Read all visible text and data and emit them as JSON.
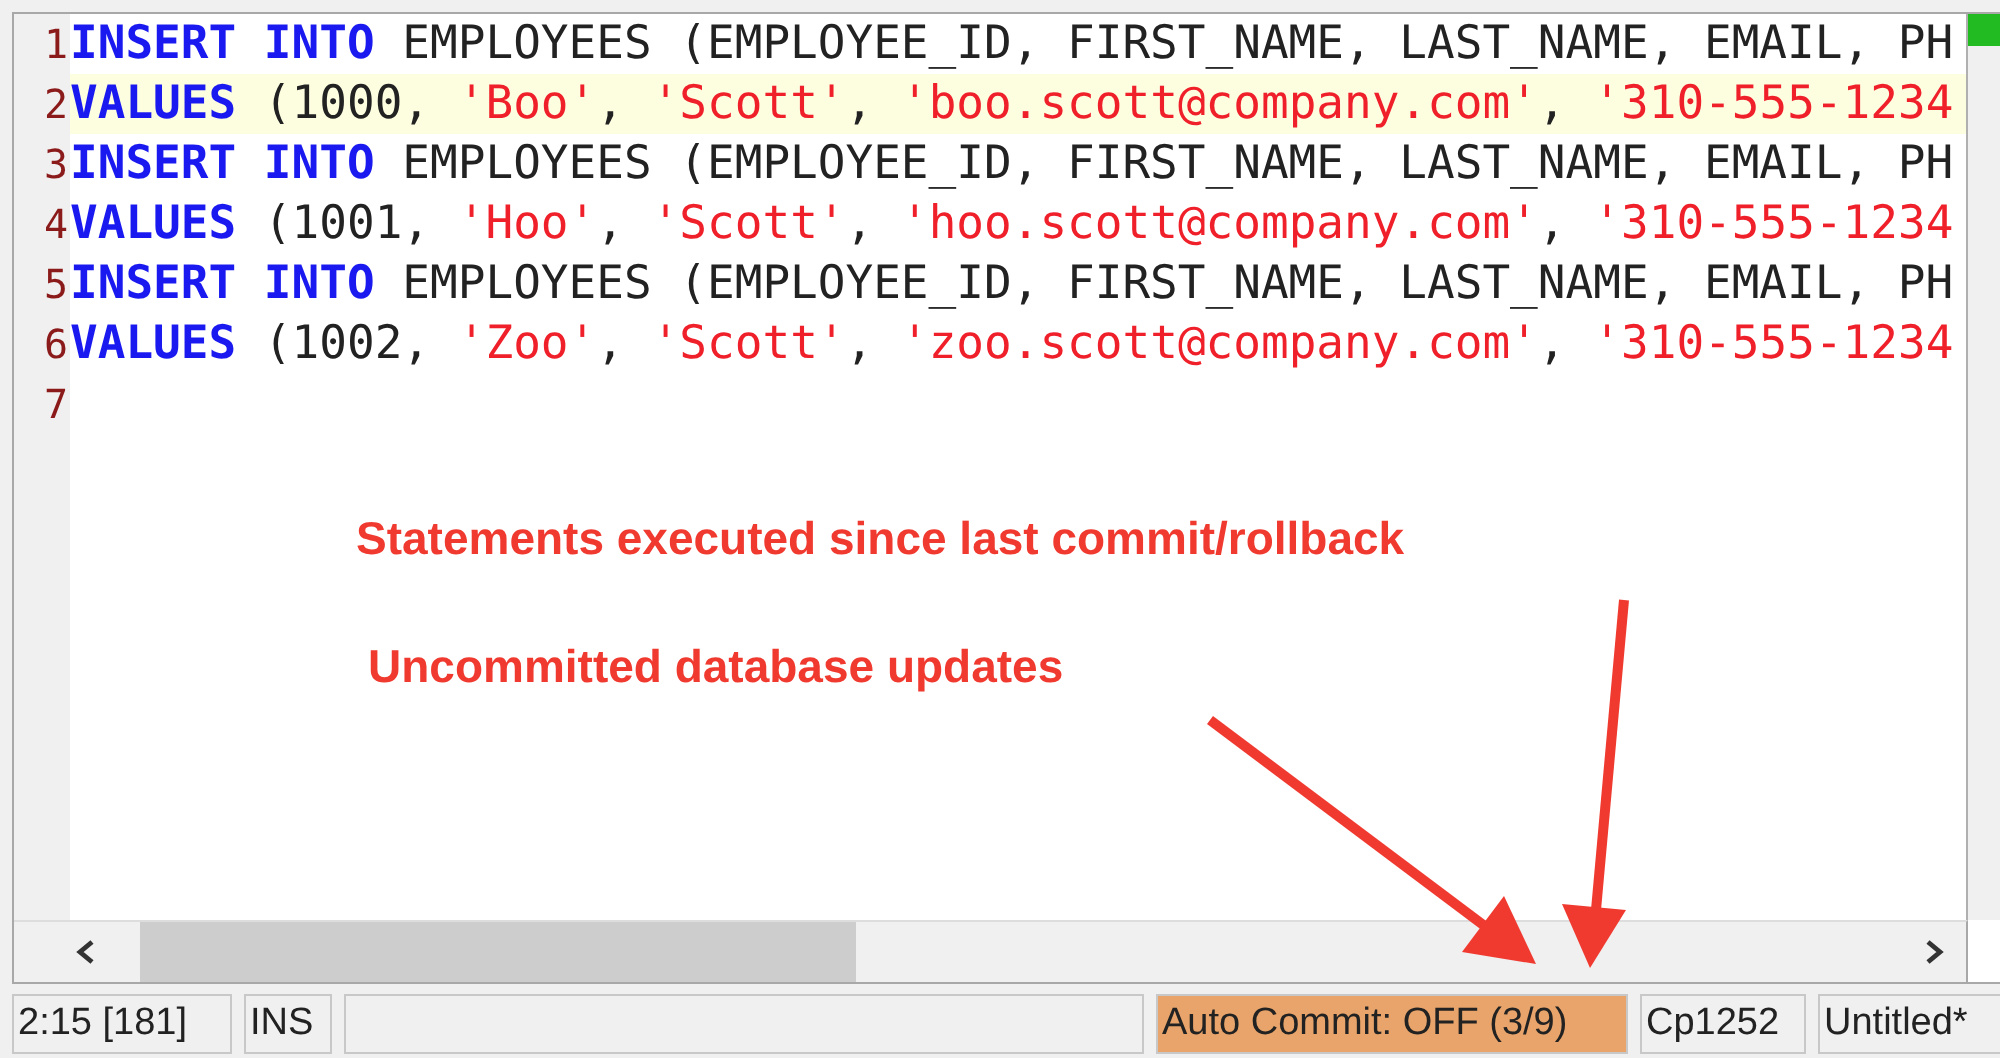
{
  "editor": {
    "lines": [
      {
        "number": "1",
        "current": false,
        "tokens": [
          {
            "kind": "keyword",
            "text": "INSERT INTO"
          },
          {
            "kind": "plain",
            "text": " EMPLOYEES (EMPLOYEE_ID, FIRST_NAME, LAST_NAME, EMAIL, PH"
          }
        ]
      },
      {
        "number": "2",
        "current": true,
        "tokens": [
          {
            "kind": "keyword",
            "text": "VALUES"
          },
          {
            "kind": "plain",
            "text": " (1000, "
          },
          {
            "kind": "string",
            "text": "'Boo'"
          },
          {
            "kind": "plain",
            "text": ", "
          },
          {
            "kind": "string",
            "text": "'Scott'"
          },
          {
            "kind": "plain",
            "text": ", "
          },
          {
            "kind": "string",
            "text": "'boo.scott@company.com'"
          },
          {
            "kind": "plain",
            "text": ", "
          },
          {
            "kind": "string",
            "text": "'310-555-1234"
          }
        ]
      },
      {
        "number": "3",
        "current": false,
        "tokens": [
          {
            "kind": "keyword",
            "text": "INSERT INTO"
          },
          {
            "kind": "plain",
            "text": " EMPLOYEES (EMPLOYEE_ID, FIRST_NAME, LAST_NAME, EMAIL, PH"
          }
        ]
      },
      {
        "number": "4",
        "current": false,
        "tokens": [
          {
            "kind": "keyword",
            "text": "VALUES"
          },
          {
            "kind": "plain",
            "text": " (1001, "
          },
          {
            "kind": "string",
            "text": "'Hoo'"
          },
          {
            "kind": "plain",
            "text": ", "
          },
          {
            "kind": "string",
            "text": "'Scott'"
          },
          {
            "kind": "plain",
            "text": ", "
          },
          {
            "kind": "string",
            "text": "'hoo.scott@company.com'"
          },
          {
            "kind": "plain",
            "text": ", "
          },
          {
            "kind": "string",
            "text": "'310-555-1234"
          }
        ]
      },
      {
        "number": "5",
        "current": false,
        "tokens": [
          {
            "kind": "keyword",
            "text": "INSERT INTO"
          },
          {
            "kind": "plain",
            "text": " EMPLOYEES (EMPLOYEE_ID, FIRST_NAME, LAST_NAME, EMAIL, PH"
          }
        ]
      },
      {
        "number": "6",
        "current": false,
        "tokens": [
          {
            "kind": "keyword",
            "text": "VALUES"
          },
          {
            "kind": "plain",
            "text": " (1002, "
          },
          {
            "kind": "string",
            "text": "'Zoo'"
          },
          {
            "kind": "plain",
            "text": ", "
          },
          {
            "kind": "string",
            "text": "'Scott'"
          },
          {
            "kind": "plain",
            "text": ", "
          },
          {
            "kind": "string",
            "text": "'zoo.scott@company.com'"
          },
          {
            "kind": "plain",
            "text": ", "
          },
          {
            "kind": "string",
            "text": "'310-555-1234"
          }
        ]
      },
      {
        "number": "7",
        "current": false
      }
    ]
  },
  "annotations": [
    "Statements executed since last commit/rollback",
    "Uncommitted database updates"
  ],
  "status_bar": [
    {
      "text": "2:15 [181]",
      "highlighted": false
    },
    {
      "text": "INS",
      "highlighted": false
    },
    {
      "highlighted": false
    },
    {
      "text": "Auto Commit: OFF (3/9)",
      "highlighted": true
    },
    {
      "text": "Cp1252",
      "highlighted": false
    },
    {
      "text": "Untitled*",
      "highlighted": false
    }
  ]
}
